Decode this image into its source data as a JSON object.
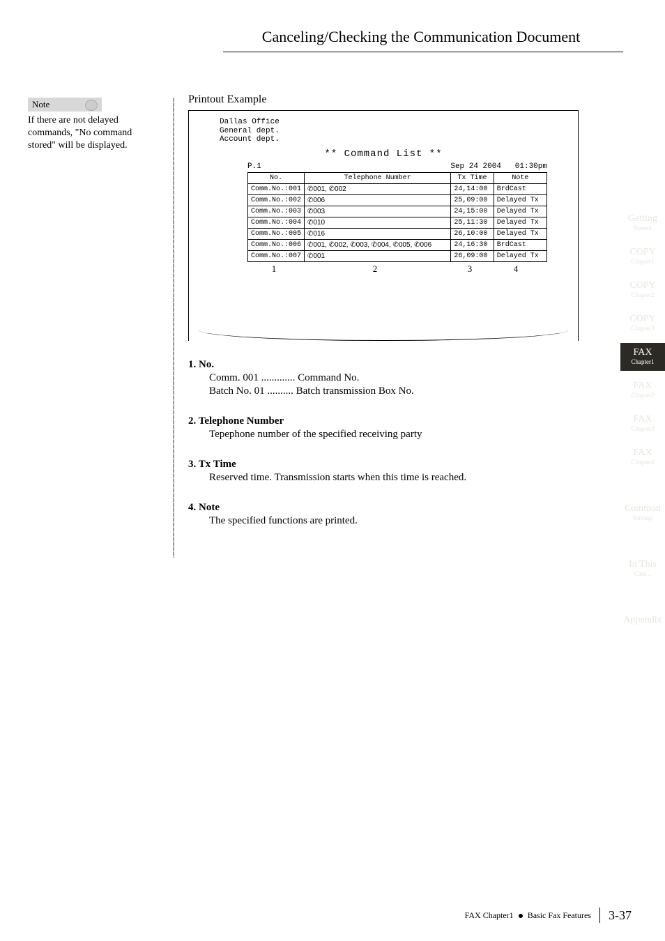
{
  "page_title": "Canceling/Checking the Communication Document",
  "note": {
    "label": "Note",
    "text": "If there are not delayed commands, \"No command stored\" will be displayed."
  },
  "printout": {
    "label": "Printout Example",
    "header_lines": [
      "Dallas Office",
      "General dept.",
      "Account dept."
    ],
    "title": "** Command List **",
    "page_no": "P.1",
    "date": "Sep 24 2004",
    "time": "01:30pm",
    "columns": [
      "No.",
      "Telephone Number",
      "Tx Time",
      "Note"
    ],
    "rows": [
      {
        "no": "Comm.No.:001",
        "tel": "✆001, ✆002",
        "tx": "24,14:00",
        "note": "BrdCast"
      },
      {
        "no": "Comm.No.:002",
        "tel": "✆006",
        "tx": "25,09:00",
        "note": "Delayed Tx"
      },
      {
        "no": "Comm.No.:003",
        "tel": "✆003",
        "tx": "24,15:00",
        "note": "Delayed Tx"
      },
      {
        "no": "Comm.No.:004",
        "tel": "✆010",
        "tx": "25,11:30",
        "note": "Delayed Tx"
      },
      {
        "no": "Comm.No.:005",
        "tel": "✆016",
        "tx": "26,10:00",
        "note": "Delayed Tx"
      },
      {
        "no": "Comm.No.:006",
        "tel": "✆001, ✆002, ✆003, ✆004, ✆005, ✆006",
        "tx": "24,16:30",
        "note": "BrdCast"
      },
      {
        "no": "Comm.No.:007",
        "tel": "✆001",
        "tx": "26,09:00",
        "note": "Delayed Tx"
      }
    ],
    "markers": [
      "1",
      "2",
      "3",
      "4"
    ]
  },
  "sections": [
    {
      "head": "1. No.",
      "body_lines": [
        "Comm. 001 ............. Command No.",
        "Batch No. 01 .......... Batch transmission Box No."
      ]
    },
    {
      "head": "2. Telephone Number",
      "body_lines": [
        "Tepephone number of the specified receiving party"
      ]
    },
    {
      "head": "3. Tx Time",
      "body_lines": [
        "Reserved time. Transmission starts when this time is reached."
      ]
    },
    {
      "head": "4. Note",
      "body_lines": [
        "The specified functions are printed."
      ]
    }
  ],
  "tabs": [
    {
      "big": "Getting",
      "sm": "Started",
      "cls": "light"
    },
    {
      "big": "COPY",
      "sm": "Chapter1",
      "cls": "light"
    },
    {
      "big": "COPY",
      "sm": "Chapter2",
      "cls": "light"
    },
    {
      "big": "COPY",
      "sm": "Chapter3",
      "cls": "light"
    },
    {
      "big": "FAX",
      "sm": "Chapter1",
      "cls": "dark"
    },
    {
      "big": "FAX",
      "sm": "Chapter2",
      "cls": "light"
    },
    {
      "big": "FAX",
      "sm": "Chapter3",
      "cls": "light"
    },
    {
      "big": "FAX",
      "sm": "Chapter4",
      "cls": "light"
    },
    {
      "big": "Common",
      "sm": "Settings",
      "cls": "light gap"
    },
    {
      "big": "In This",
      "sm": "Case...",
      "cls": "light gap"
    },
    {
      "big": "Appendix",
      "sm": "",
      "cls": "light gap"
    }
  ],
  "footer": {
    "text": "FAX Chapter1   Basic Fax Features",
    "page": "3-37"
  }
}
